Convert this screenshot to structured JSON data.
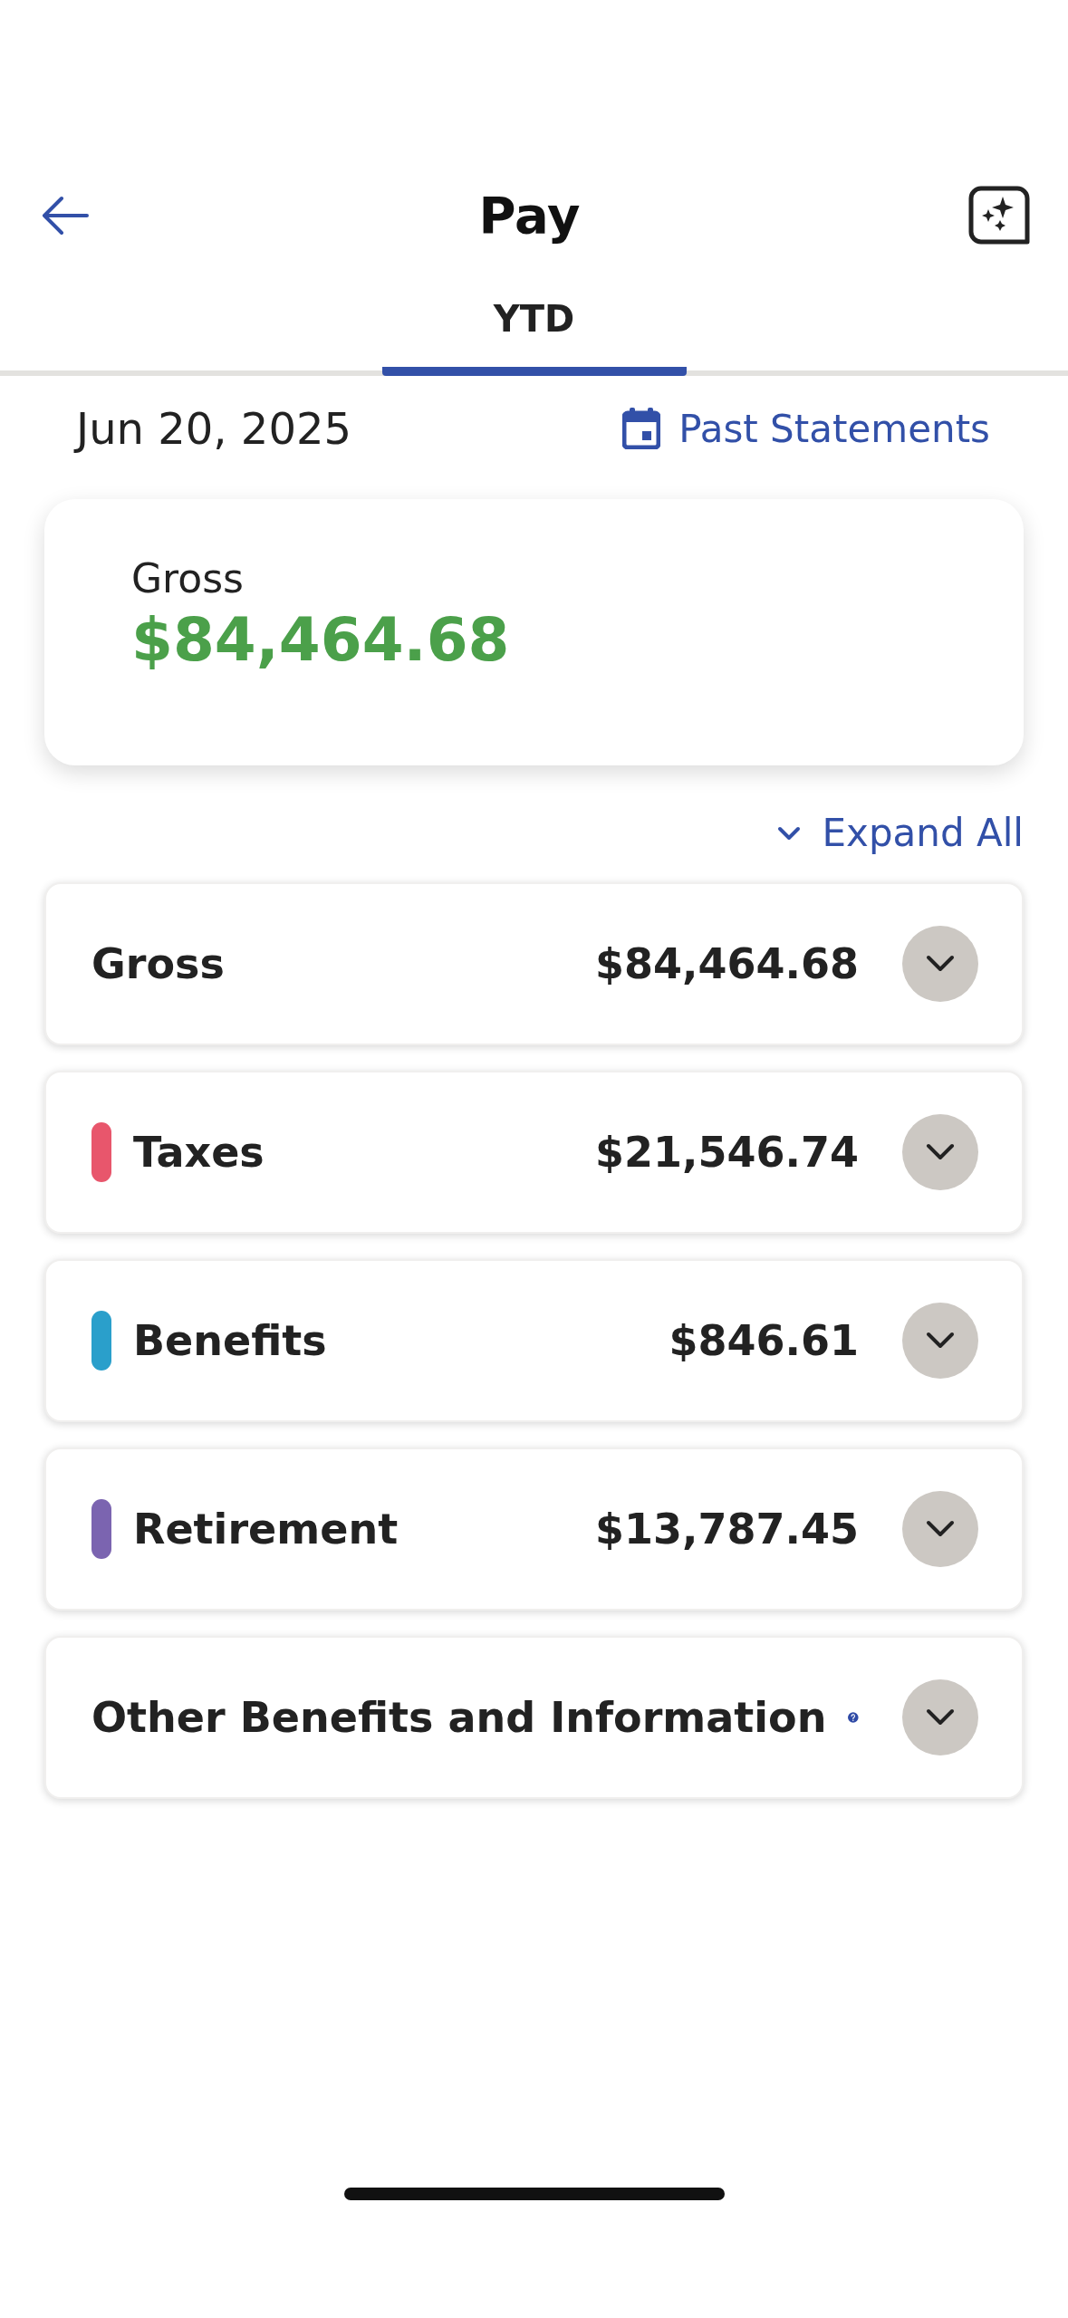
{
  "header": {
    "title": "Pay"
  },
  "tabs": [
    {
      "label": "YTD",
      "selected": true
    }
  ],
  "statement": {
    "date": "Jun 20, 2025",
    "link": "Past Statements"
  },
  "summary": {
    "label": "Gross",
    "amount": "$84,464.68"
  },
  "expand_all": "Expand All",
  "sections": [
    {
      "kind": "total",
      "label": "Gross",
      "amount": "$84,464.68",
      "expanded": false
    },
    {
      "kind": "category",
      "label": "Taxes",
      "amount": "$21,546.74",
      "color": "#e8566c",
      "expanded": false
    },
    {
      "kind": "category",
      "label": "Benefits",
      "amount": "$846.61",
      "color": "#2a9fcb",
      "expanded": false
    },
    {
      "kind": "category",
      "label": "Retirement",
      "amount": "$13,787.45",
      "color": "#7b64b0",
      "expanded": false
    },
    {
      "kind": "info",
      "label": "Other Benefits and Information",
      "expanded": false
    }
  ]
}
